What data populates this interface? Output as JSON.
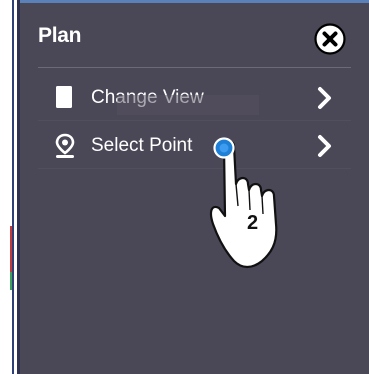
{
  "panel": {
    "title": "Plan",
    "close_icon": "close-circle-icon",
    "items": [
      {
        "label": "Change View",
        "icon": "page-icon",
        "chevron": "chevron-right-icon"
      },
      {
        "label": "Select Point",
        "icon": "map-pin-icon",
        "chevron": "chevron-right-icon"
      }
    ]
  },
  "overlay": {
    "step_number": "2",
    "pointer_icon": "tap-hand-icon",
    "tap_indicator_color": "#1e7fd6"
  },
  "colors": {
    "panel_bg": "#4a4757",
    "text": "#ffffff",
    "divider": "#6c6a78"
  }
}
